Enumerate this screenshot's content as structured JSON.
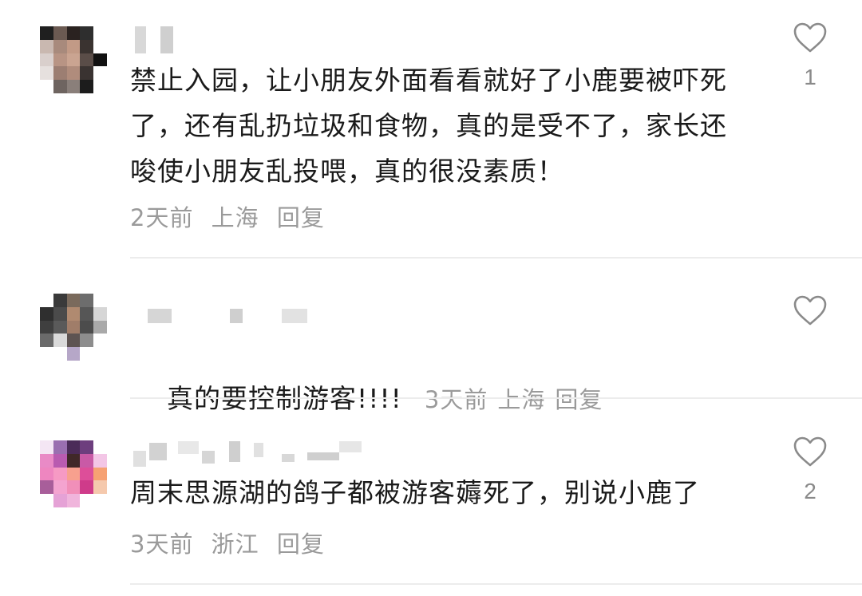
{
  "comments": [
    {
      "text": "禁止入园，让小朋友外面看看就好了小鹿要被吓死了，还有乱扔垃圾和食物，真的是受不了，家长还唆使小朋友乱投喂，真的很没素质！",
      "time": "2天前",
      "location": "上海",
      "reply": "回复",
      "likes": "1"
    },
    {
      "text": "真的要控制游客!!!!",
      "time": "3天前",
      "location": "上海",
      "reply": "回复",
      "likes": ""
    },
    {
      "text": "周末思源湖的鸽子都被游客薅死了，别说小鹿了",
      "time": "3天前",
      "location": "浙江",
      "reply": "回复",
      "likes": "2"
    }
  ],
  "icons": {
    "like": "heart-outline-icon"
  },
  "colors": {
    "text": "#1a1a1a",
    "meta": "#9a9a9a",
    "icon": "#8a8a8a",
    "divider": "#ececec"
  }
}
